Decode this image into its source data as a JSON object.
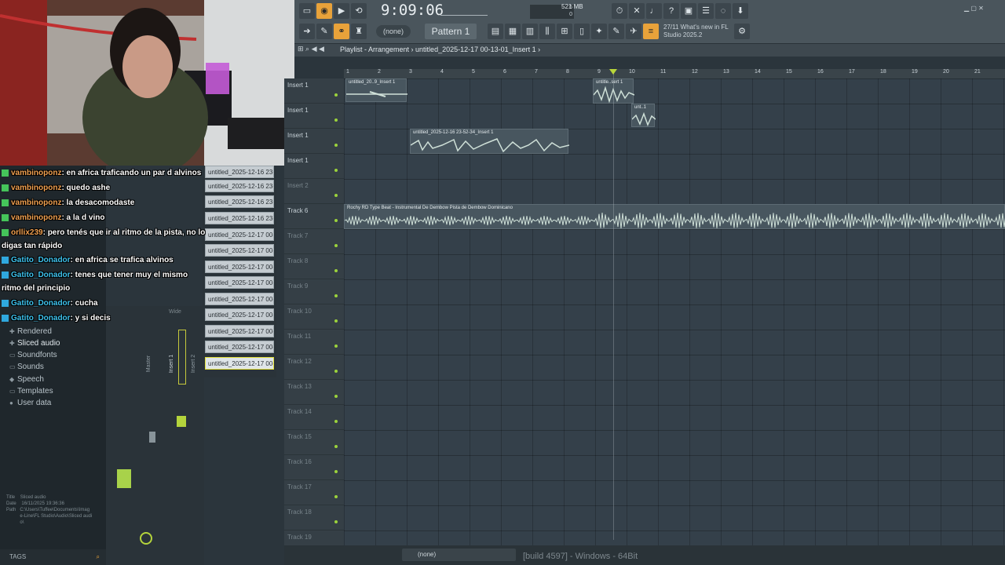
{
  "toolbar": {
    "clock": "9:09:06",
    "memory": "521 MB",
    "pattern": "Pattern 1",
    "none_select": "(none)",
    "news": "27/11  What's new in FL Studio 2025.2",
    "cpu_value": "6",
    "cpu_value2": "0"
  },
  "playlist": {
    "title": "Playlist - Arrangement",
    "breadcrumb": "untitled_2025-12-17 00-13-01_Insert 1",
    "ruler": [
      "1",
      "2",
      "3",
      "4",
      "5",
      "6",
      "7",
      "8",
      "9",
      "10",
      "11",
      "12",
      "13",
      "14",
      "15",
      "16",
      "17",
      "18",
      "19",
      "20",
      "21"
    ],
    "tracks": [
      {
        "name": "Insert 1",
        "dim": false
      },
      {
        "name": "Insert 1",
        "dim": false
      },
      {
        "name": "Insert 1",
        "dim": false
      },
      {
        "name": "Insert 1",
        "dim": false
      },
      {
        "name": "Insert 2",
        "dim": true
      },
      {
        "name": "Track 6",
        "dim": false
      },
      {
        "name": "Track 7",
        "dim": true
      },
      {
        "name": "Track 8",
        "dim": true
      },
      {
        "name": "Track 9",
        "dim": true
      },
      {
        "name": "Track 10",
        "dim": true
      },
      {
        "name": "Track 11",
        "dim": true
      },
      {
        "name": "Track 12",
        "dim": true
      },
      {
        "name": "Track 13",
        "dim": true
      },
      {
        "name": "Track 14",
        "dim": true
      },
      {
        "name": "Track 15",
        "dim": true
      },
      {
        "name": "Track 16",
        "dim": true
      },
      {
        "name": "Track 17",
        "dim": true
      },
      {
        "name": "Track 18",
        "dim": true
      },
      {
        "name": "Track 19",
        "dim": true
      }
    ],
    "regions": [
      {
        "label": "untitled_20..9_Insert 1"
      },
      {
        "label": "untitle..sert 1"
      },
      {
        "label": "unt..1"
      },
      {
        "label": "untitled_2025-12-16 23-52-34_Insert 1"
      },
      {
        "label": "Rochy RD Type Beat - Instrumental De Dembow  Pista de Dembow Dominicano"
      }
    ]
  },
  "clips": [
    "untitled_2025-12-16 23-...",
    "untitled_2025-12-16 23-...",
    "untitled_2025-12-16 23-...",
    "untitled_2025-12-16 23-...",
    "untitled_2025-12-17 00-...",
    "untitled_2025-12-17 00-...",
    "untitled_2025-12-17 00-...",
    "untitled_2025-12-17 00-...",
    "untitled_2025-12-17 00-...",
    "untitled_2025-12-17 00-...",
    "untitled_2025-12-17 00-...",
    "untitled_2025-12-17 00-...",
    "untitled_2025-12-17 00-..."
  ],
  "browser": {
    "items": [
      {
        "label": "Rendered",
        "icon": "plus-icon"
      },
      {
        "label": "Sliced audio",
        "icon": "plus-icon"
      },
      {
        "label": "Soundfonts",
        "icon": "folder-icon"
      },
      {
        "label": "Sounds",
        "icon": "folder-icon"
      },
      {
        "label": "Speech",
        "icon": "speech-icon"
      },
      {
        "label": "Templates",
        "icon": "folder-icon"
      },
      {
        "label": "User data",
        "icon": "user-icon"
      }
    ],
    "info": {
      "title_label": "Title",
      "title_value": "Sliced audio",
      "date_label": "Date",
      "date_value": "16/11/2025 19:36:36",
      "path_label": "Path",
      "path_value": "C:\\Users\\Tuffee\\Documents\\Image-Line\\FL Studio\\Audio\\Sliced audio\\"
    },
    "tags": "TAGS"
  },
  "mixer": {
    "labels": [
      "Master",
      "Insert 1",
      "Insert 2"
    ],
    "wide": "Wide"
  },
  "chat": [
    {
      "user": "vambinoponz",
      "text": ": en africa traficando un par d alvinos",
      "style": "u1",
      "badge": "b1"
    },
    {
      "user": "vambinoponz",
      "text": ": quedo ashe",
      "style": "u1",
      "badge": "b1"
    },
    {
      "user": "vambinoponz",
      "text": ": la desacomodaste",
      "style": "u1",
      "badge": "b1"
    },
    {
      "user": "vambinoponz",
      "text": ": a la d vino",
      "style": "u1",
      "badge": "b1"
    },
    {
      "user": "orllix239",
      "text": ": pero tenés que ir al ritmo de la pista, no lo",
      "style": "u1",
      "badge": "b1"
    },
    {
      "user": "",
      "text": "digas tan rápido",
      "style": "",
      "badge": ""
    },
    {
      "user": "Gatito_Donador",
      "text": ": en africa se trafica alvinos",
      "style": "u2",
      "badge": "b2"
    },
    {
      "user": "Gatito_Donador",
      "text": ": tenes que tener muy el mismo",
      "style": "u2",
      "badge": "b2"
    },
    {
      "user": "",
      "text": "ritmo del principio",
      "style": "",
      "badge": ""
    },
    {
      "user": "Gatito_Donador",
      "text": ": cucha",
      "style": "u2",
      "badge": "b2"
    },
    {
      "user": "Gatito_Donador",
      "text": ": y si decis",
      "style": "u2",
      "badge": "b2"
    }
  ],
  "status": {
    "build": "[build 4597] - Windows - 64Bit",
    "none": "(none)"
  },
  "colors": {
    "accent": "#e8a23a",
    "waveform": "#cfe0d8",
    "grid": "#34404a"
  }
}
